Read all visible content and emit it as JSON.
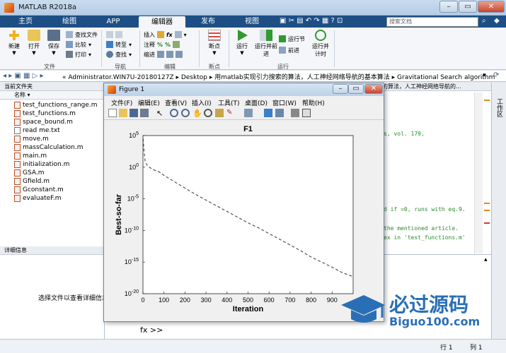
{
  "app": {
    "title": "MATLAB R2018a"
  },
  "tabs": [
    "主页",
    "绘图",
    "APP",
    "编辑器",
    "发布",
    "视图"
  ],
  "active_tab": "编辑器",
  "search": {
    "placeholder": "搜索文档"
  },
  "ribbon": {
    "file_group": {
      "label": "文件",
      "new": "新建",
      "open": "打开",
      "save": "保存",
      "find_files": "查找文件",
      "compare": "比较",
      "print": "打印"
    },
    "nav_group": {
      "label": "导航",
      "goto": "转至",
      "find": "查找"
    },
    "edit_group": {
      "label": "编辑",
      "insert": "插入",
      "comment": "注释",
      "indent": "缩进",
      "fx": "fx"
    },
    "breakpoint_group": {
      "label": "断点",
      "breakpoints": "断点"
    },
    "run_group": {
      "label": "运行",
      "run": "运行",
      "run_advance": "运行并前进",
      "run_section": "运行节",
      "advance": "前进",
      "run_time": "运行并计时"
    }
  },
  "address": {
    "segments": [
      "Administrator.WIN7U-20180127Z",
      "Desktop",
      "用matlab实现引力搜索的算法，人工神经网络导航的基本算法",
      "Gravitational Search algorithm"
    ]
  },
  "current_folder": {
    "header": "当前文件夹",
    "column": "名称",
    "files": [
      "test_functions_range.m",
      "test_functions.m",
      "space_bound.m",
      "read me.txt",
      "move.m",
      "massCalculation.m",
      "main.m",
      "initialization.m",
      "GSA.m",
      "Gfield.m",
      "Gconstant.m",
      "evaluateF.m"
    ]
  },
  "details": {
    "header": "详细信息",
    "placeholder": "选择文件以查看详细信息"
  },
  "editor_tab": "的算法，人工神经网络导航的...",
  "editor_lines": [
    "s, vol. 179,",
    "d if =0, runs with eq.9.",
    "the mentioned article.",
    "ex in 'test_functions.m'"
  ],
  "workspace_label": "工作区",
  "command_prompt": "fx >>",
  "status": {
    "line": "行 1",
    "col": "列 1"
  },
  "figure": {
    "title": "Figure 1",
    "menu": [
      "文件(F)",
      "编辑(E)",
      "查看(V)",
      "插入(I)",
      "工具(T)",
      "桌面(D)",
      "窗口(W)",
      "帮助(H)"
    ]
  },
  "chart_data": {
    "type": "line",
    "title": "F1",
    "xlabel": "Iteration",
    "ylabel": "Best-so-far",
    "xlim": [
      0,
      1000
    ],
    "ylim_log10": [
      -20,
      5
    ],
    "yscale": "log",
    "x_ticks": [
      0,
      100,
      200,
      300,
      400,
      500,
      600,
      700,
      800,
      900
    ],
    "y_ticks": [
      "10^5",
      "10^0",
      "10^-5",
      "10^-10",
      "10^-15",
      "10^-20"
    ],
    "series": [
      {
        "style": "dashed",
        "color": "#333333",
        "x": [
          1,
          5,
          10,
          20,
          30,
          50,
          80,
          100,
          150,
          200,
          250,
          300,
          350,
          400,
          450,
          500,
          550,
          600,
          650,
          700,
          750,
          800,
          850,
          900,
          950,
          1000
        ],
        "y_log10": [
          4.5,
          2.5,
          1.0,
          0.3,
          0.0,
          -0.4,
          -0.8,
          -1.3,
          -2.3,
          -3.3,
          -4.3,
          -5.2,
          -6.1,
          -7.0,
          -7.9,
          -8.8,
          -9.6,
          -10.5,
          -11.4,
          -12.3,
          -13.2,
          -14.2,
          -15.0,
          -15.8,
          -16.7,
          -17.3
        ]
      }
    ]
  },
  "watermark": {
    "brand": "必过源码",
    "url": "Biguo100.com"
  },
  "colors": {
    "tab_strip": "#1d4f85",
    "accent_green": "#3a9b34",
    "run_green": "#2f9a2f"
  }
}
